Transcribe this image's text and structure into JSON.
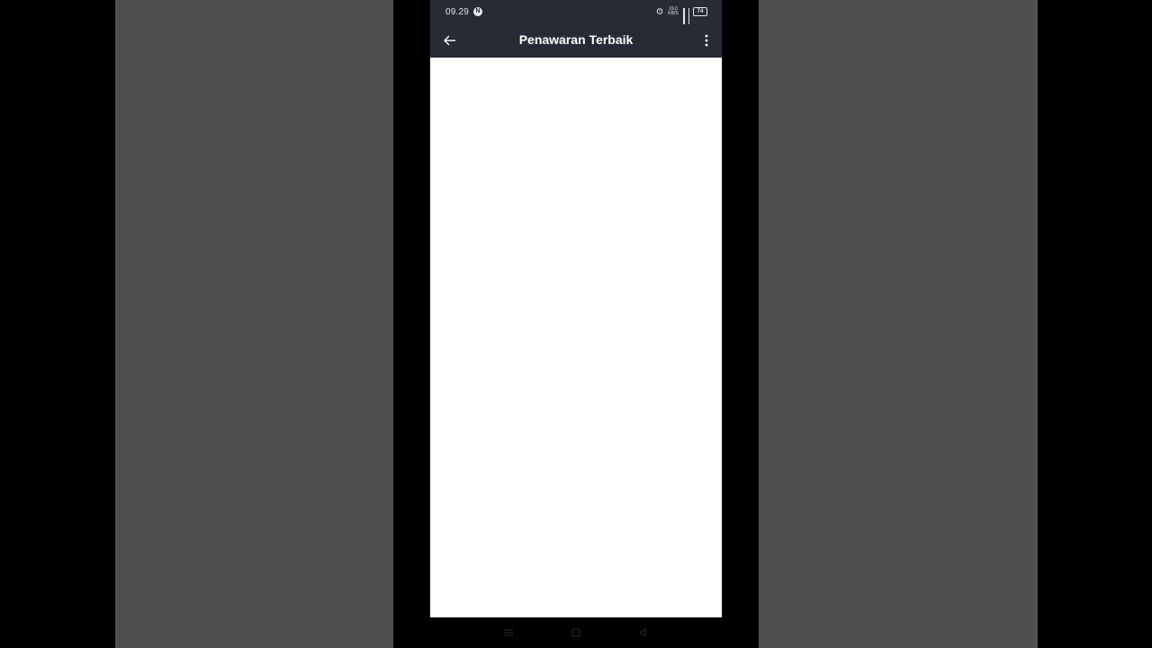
{
  "status_bar": {
    "time": "09.29",
    "notification_badge": "N",
    "net_speed_value": "19,0",
    "net_speed_unit": "KB/S",
    "battery": "74"
  },
  "app_bar": {
    "title": "Penawaran Terbaik",
    "back_icon": "arrow-left-icon",
    "more_icon": "more-vertical-icon"
  },
  "nav_bar": {
    "menu_icon": "menu-lines-icon",
    "home_icon": "home-square-icon",
    "back_icon": "back-triangle-icon"
  },
  "colors": {
    "app_bar_bg": "#262b35",
    "side_panel_bg": "#4f4f4f",
    "content_bg": "#ffffff",
    "frame_bg": "#000000"
  }
}
